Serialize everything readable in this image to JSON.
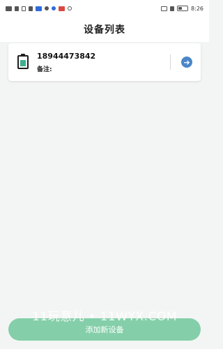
{
  "status_bar": {
    "time": "8:26",
    "left_icons": [
      "signal-icon",
      "wifi-icon",
      "sim-icon",
      "app-icon",
      "notification-icon"
    ],
    "right_icons": [
      "nfc-icon",
      "bluetooth-icon",
      "battery-icon"
    ]
  },
  "header": {
    "title": "设备列表"
  },
  "devices": [
    {
      "phone": "18944473842",
      "note_label": "备注:",
      "icon": "device-icon",
      "action_icon": "arrow-right-circle-icon"
    }
  ],
  "footer": {
    "add_button_label": "添加新设备"
  },
  "watermark": "11玩意儿 • 11WYX.COM",
  "colors": {
    "background": "#f3f5f4",
    "card_bg": "#ffffff",
    "accent_green": "#84cfa9",
    "device_icon_green": "#3fb08f",
    "arrow_blue": "#4a86c8"
  }
}
